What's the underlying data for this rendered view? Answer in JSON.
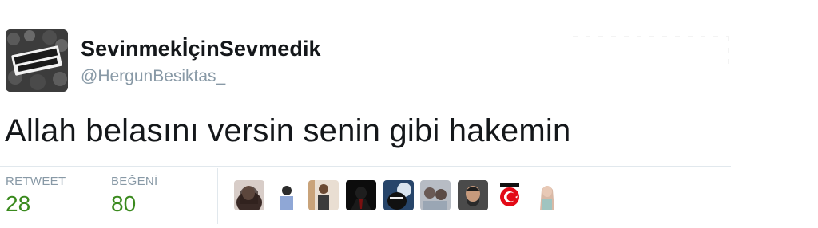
{
  "user": {
    "display_name": "SevinmekİçinSevmedik",
    "handle": "@HergunBesiktas_",
    "avatar_icon": "avatar-image"
  },
  "tweet": {
    "text": "Allah belasını versin senin gibi hakemin"
  },
  "stats": {
    "retweet_label": "RETWEET",
    "retweet_count": "28",
    "like_label": "BEĞENİ",
    "like_count": "80"
  },
  "likers": [
    {
      "name": "liker-avatar-1",
      "color": "#5a4a44"
    },
    {
      "name": "liker-avatar-2",
      "color": "#cfd7e6"
    },
    {
      "name": "liker-avatar-3",
      "color": "#d9c7b6"
    },
    {
      "name": "liker-avatar-4",
      "color": "#111111"
    },
    {
      "name": "liker-avatar-5",
      "color": "#2e4f73"
    },
    {
      "name": "liker-avatar-6",
      "color": "#8a8f9a"
    },
    {
      "name": "liker-avatar-7",
      "color": "#3b3b3b"
    },
    {
      "name": "liker-avatar-8",
      "color": "#ffffff"
    },
    {
      "name": "liker-avatar-9",
      "color": "#e7d3c6"
    }
  ],
  "colors": {
    "count": "#3a8a1e",
    "muted": "#8899a6",
    "text": "#14171a",
    "divider": "#e1e8ed"
  }
}
